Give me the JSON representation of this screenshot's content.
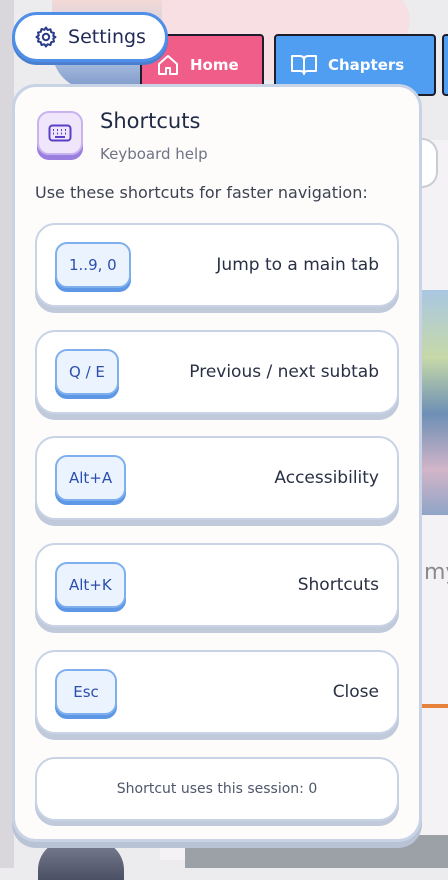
{
  "settings": {
    "label": "Settings",
    "icon": "gear-icon"
  },
  "nav": {
    "tabs": [
      {
        "label": "Home",
        "icon": "house-icon",
        "color": "#ef5d88"
      },
      {
        "label": "Chapters",
        "icon": "book-icon",
        "color": "#4f9ef2"
      }
    ]
  },
  "shortcuts_panel": {
    "title": "Shortcuts",
    "subtitle": "Keyboard help",
    "description": "Use these shortcuts for faster navigation:",
    "icon": "keyboard-icon",
    "items": [
      {
        "key": "1..9, 0",
        "action": "Jump to a main tab"
      },
      {
        "key": "Q / E",
        "action": "Previous / next subtab"
      },
      {
        "key": "Alt+A",
        "action": "Accessibility"
      },
      {
        "key": "Alt+K",
        "action": "Shortcuts"
      },
      {
        "key": "Esc",
        "action": "Close"
      }
    ],
    "usage_text": "Shortcut uses this session: 0"
  },
  "background_text": {
    "partial_word": "my"
  },
  "colors": {
    "accent_blue": "#4f8fe8",
    "home_pink": "#ef5d88",
    "chapters_blue": "#4f9ef2",
    "key_text": "#2c4fae"
  }
}
